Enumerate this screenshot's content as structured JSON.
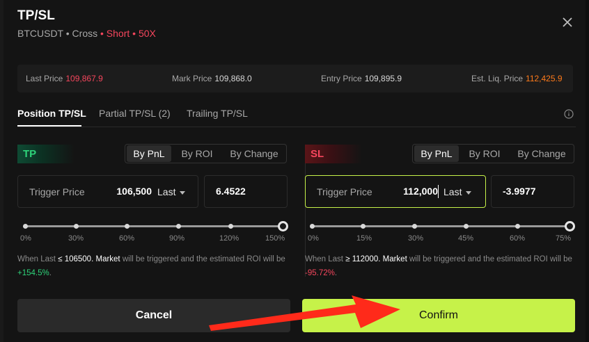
{
  "header": {
    "title": "TP/SL",
    "symbol": "BTCUSDT",
    "mode": "Cross",
    "side": "Short",
    "leverage": "50X",
    "sep": "•"
  },
  "prices": {
    "last_label": "Last Price",
    "last_value": "109,867.9",
    "mark_label": "Mark Price",
    "mark_value": "109,868.0",
    "entry_label": "Entry Price",
    "entry_value": "109,895.9",
    "liq_label": "Est. Liq. Price",
    "liq_value": "112,425.9"
  },
  "tabs": [
    "Position TP/SL",
    "Partial TP/SL (2)",
    "Trailing TP/SL"
  ],
  "tp": {
    "badge": "TP",
    "modes": [
      "By PnL",
      "By ROI",
      "By Change"
    ],
    "trigger_label": "Trigger Price",
    "trigger_value": "106,500",
    "price_type": "Last",
    "pnl_value": "6.4522",
    "ticks": [
      "0%",
      "30%",
      "60%",
      "90%",
      "120%",
      "150%"
    ],
    "slider_fraction": 1.0,
    "note_prefix": "When Last",
    "note_op": "≤",
    "note_price": "106500.",
    "note_mid1": "Market",
    "note_mid2": "will be triggered and the estimated ROI will be",
    "note_roi": "+154.5%",
    "note_end": "."
  },
  "sl": {
    "badge": "SL",
    "modes": [
      "By PnL",
      "By ROI",
      "By Change"
    ],
    "trigger_label": "Trigger Price",
    "trigger_value": "112,000",
    "price_type": "Last",
    "pnl_value": "-3.9977",
    "ticks": [
      "0%",
      "15%",
      "30%",
      "45%",
      "60%",
      "75%"
    ],
    "slider_fraction": 1.0,
    "note_prefix": "When Last",
    "note_op": "≥",
    "note_price": "112000.",
    "note_mid1": "Market",
    "note_mid2": "will be triggered and the estimated ROI will be",
    "note_roi": "-95.72%",
    "note_end": "."
  },
  "buttons": {
    "cancel": "Cancel",
    "confirm": "Confirm"
  },
  "colors": {
    "accent": "#c6f249",
    "red": "#f6465d",
    "green": "#2ed47a",
    "liq": "#ff7a1a",
    "annotation_arrow": "#ff2a1a"
  }
}
